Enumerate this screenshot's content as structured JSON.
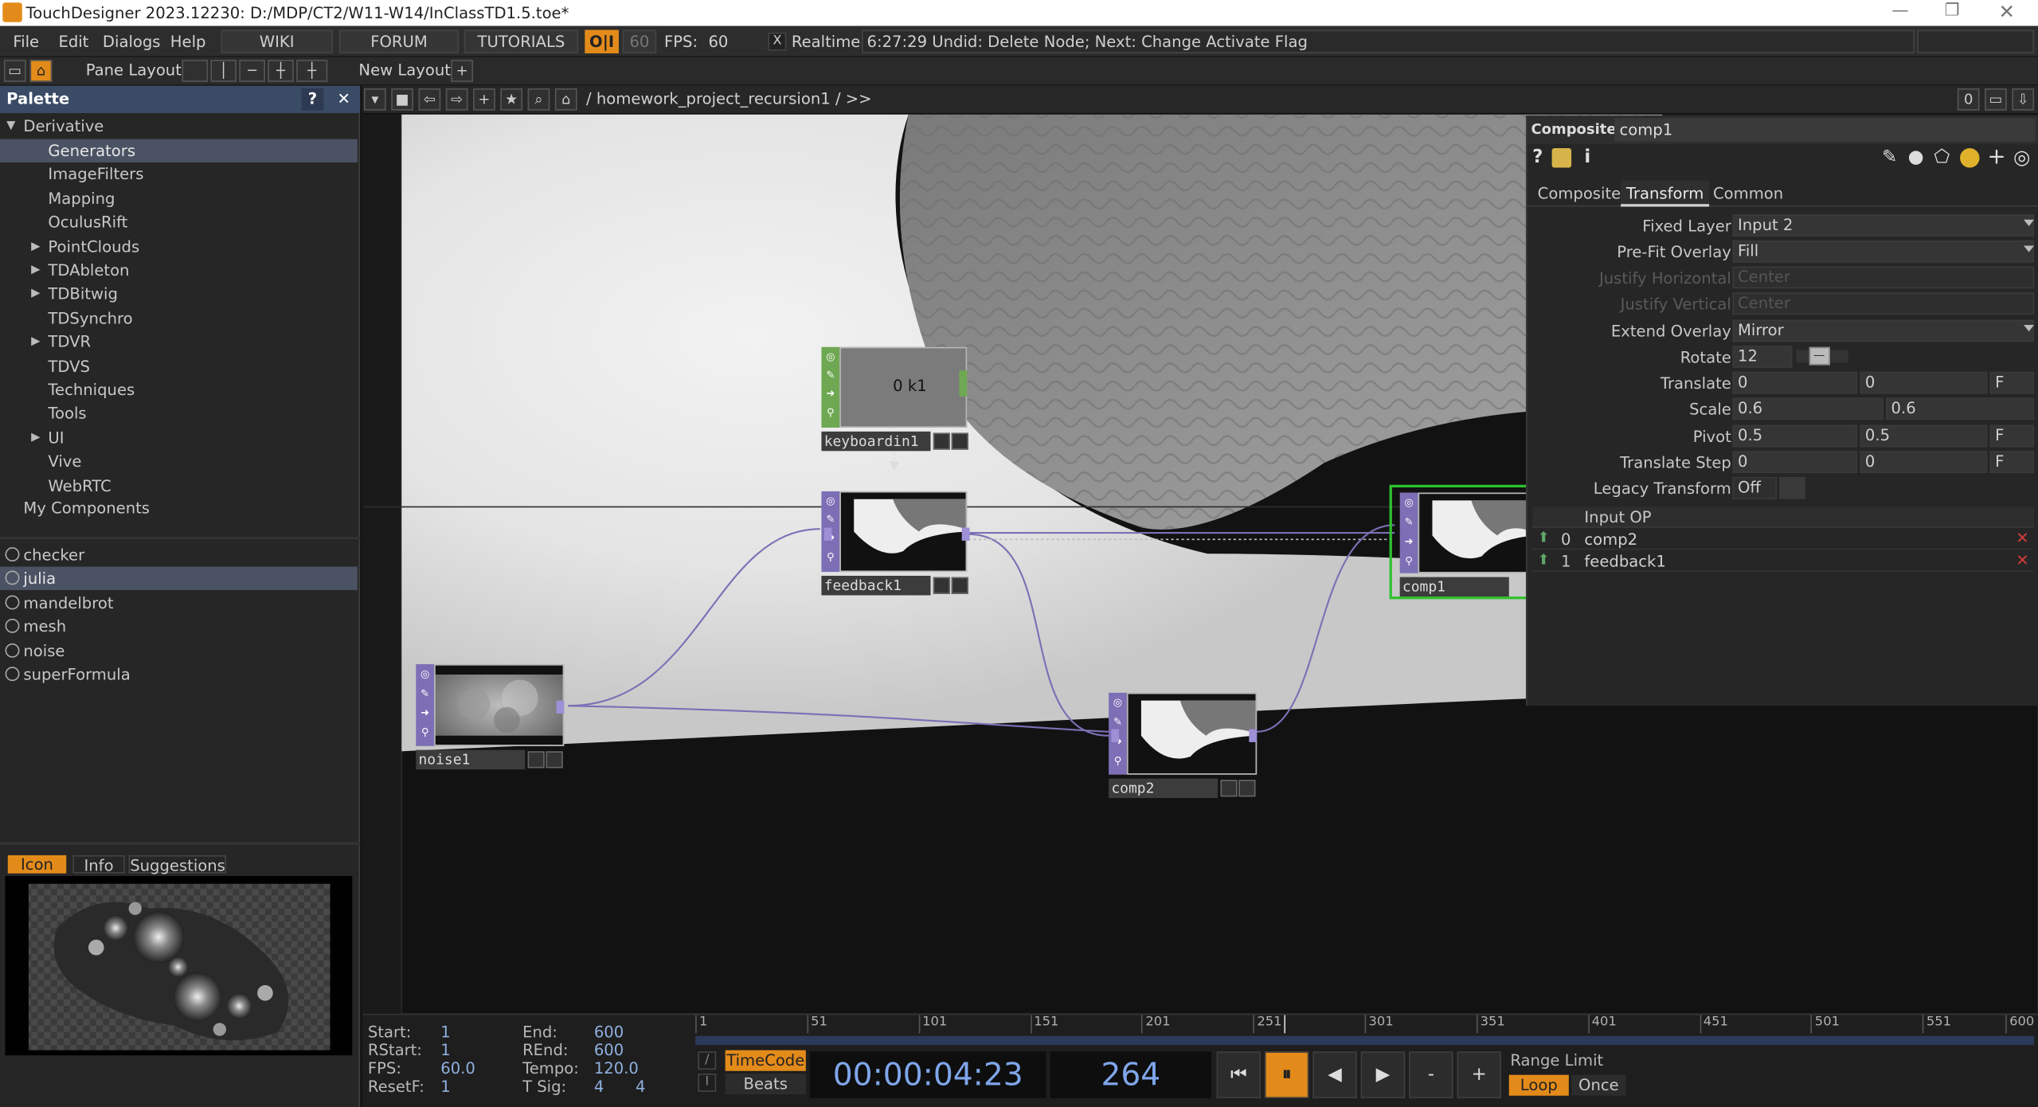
{
  "window": {
    "title": "TouchDesigner 2023.12230: D:/MDP/CT2/W11-W14/InClassTD1.5.toe*"
  },
  "menu": {
    "items": [
      "File",
      "Edit",
      "Dialogs",
      "Help"
    ],
    "wiki": "WIKI",
    "forum": "FORUM",
    "tutorials": "TUTORIALS",
    "oi": "O|I",
    "fps_target": "60",
    "fps_label": "FPS:",
    "fps_value": "60",
    "realtime_check": "X",
    "realtime": "Realtime",
    "status": "6:27:29 Undid: Delete Node; Next: Change Activate Flag"
  },
  "panebar": {
    "pane_layout": "Pane Layout",
    "new_layout": "New Layout",
    "plus": "+"
  },
  "palette": {
    "title": "Palette",
    "help": "?",
    "close": "✕",
    "root": "Derivative",
    "tree": [
      {
        "label": "Generators",
        "selected": true,
        "expandable": false
      },
      {
        "label": "ImageFilters",
        "expandable": false
      },
      {
        "label": "Mapping",
        "expandable": false
      },
      {
        "label": "OculusRift",
        "expandable": false
      },
      {
        "label": "PointClouds",
        "expandable": true
      },
      {
        "label": "TDAbleton",
        "expandable": true
      },
      {
        "label": "TDBitwig",
        "expandable": true
      },
      {
        "label": "TDSynchro",
        "expandable": false
      },
      {
        "label": "TDVR",
        "expandable": true
      },
      {
        "label": "TDVS",
        "expandable": false
      },
      {
        "label": "Techniques",
        "expandable": false
      },
      {
        "label": "Tools",
        "expandable": false
      },
      {
        "label": "UI",
        "expandable": true
      },
      {
        "label": "Vive",
        "expandable": false
      },
      {
        "label": "WebRTC",
        "expandable": false
      }
    ],
    "my_components": "My Components",
    "components": [
      {
        "label": "checker"
      },
      {
        "label": "julia",
        "selected": true
      },
      {
        "label": "mandelbrot"
      },
      {
        "label": "mesh"
      },
      {
        "label": "noise"
      },
      {
        "label": "superFormula"
      }
    ],
    "tabs": {
      "icon": "Icon",
      "info": "Info",
      "suggestions": "Suggestions"
    }
  },
  "network": {
    "path": "/ homework_project_recursion1 / >>",
    "counter": "0",
    "nodes": {
      "keyboard": {
        "name": "keyboardin1",
        "readout": "0 k1"
      },
      "feedback": {
        "name": "feedback1"
      },
      "noise": {
        "name": "noise1"
      },
      "comp2": {
        "name": "comp2"
      },
      "comp1": {
        "name": "comp1"
      }
    }
  },
  "params": {
    "type": "Composite",
    "name": "comp1",
    "tabs": [
      "Composite",
      "Transform",
      "Common"
    ],
    "active_tab": "Transform",
    "fixed_layer": {
      "label": "Fixed Layer",
      "value": "Input 2"
    },
    "prefit": {
      "label": "Pre-Fit Overlay",
      "value": "Fill"
    },
    "justify_h": {
      "label": "Justify Horizontal",
      "value": "Center"
    },
    "justify_v": {
      "label": "Justify Vertical",
      "value": "Center"
    },
    "extend": {
      "label": "Extend Overlay",
      "value": "Mirror"
    },
    "rotate": {
      "label": "Rotate",
      "value": "12",
      "fraction": 0.24
    },
    "translate": {
      "label": "Translate",
      "x": "0",
      "y": "0",
      "unit": "F"
    },
    "scale": {
      "label": "Scale",
      "x": "0.6",
      "y": "0.6"
    },
    "pivot": {
      "label": "Pivot",
      "x": "0.5",
      "y": "0.5",
      "unit": "F"
    },
    "translate_step": {
      "label": "Translate Step",
      "x": "0",
      "y": "0",
      "unit": "F"
    },
    "legacy": {
      "label": "Legacy Transform",
      "value": "Off"
    },
    "inputs_header": "Input OP",
    "inputs": [
      {
        "idx": "0",
        "name": "comp2"
      },
      {
        "idx": "1",
        "name": "feedback1"
      }
    ]
  },
  "timeline": {
    "start_l": "Start:",
    "start": "1",
    "end_l": "End:",
    "end": "600",
    "rstart_l": "RStart:",
    "rstart": "1",
    "rend_l": "REnd:",
    "rend": "600",
    "fps_l": "FPS:",
    "fps": "60.0",
    "tempo_l": "Tempo:",
    "tempo": "120.0",
    "resetf_l": "ResetF:",
    "resetf": "1",
    "tsig_l": "T Sig:",
    "tsig_a": "4",
    "tsig_b": "4",
    "ruler": [
      "1",
      "51",
      "101",
      "151",
      "201",
      "251",
      "301",
      "351",
      "401",
      "451",
      "501",
      "551",
      "600"
    ],
    "timecode_btn": "TimeCode",
    "beats_btn": "Beats",
    "timecode": "00:00:04:23",
    "frame": "264",
    "range_limit": "Range Limit",
    "loop": "Loop",
    "once": "Once",
    "position": 0.44
  },
  "colors": {
    "accent": "#e38b1a",
    "top_op": "#7d6fb5",
    "chop_op": "#6fa852",
    "selected": "#2ec22e"
  }
}
